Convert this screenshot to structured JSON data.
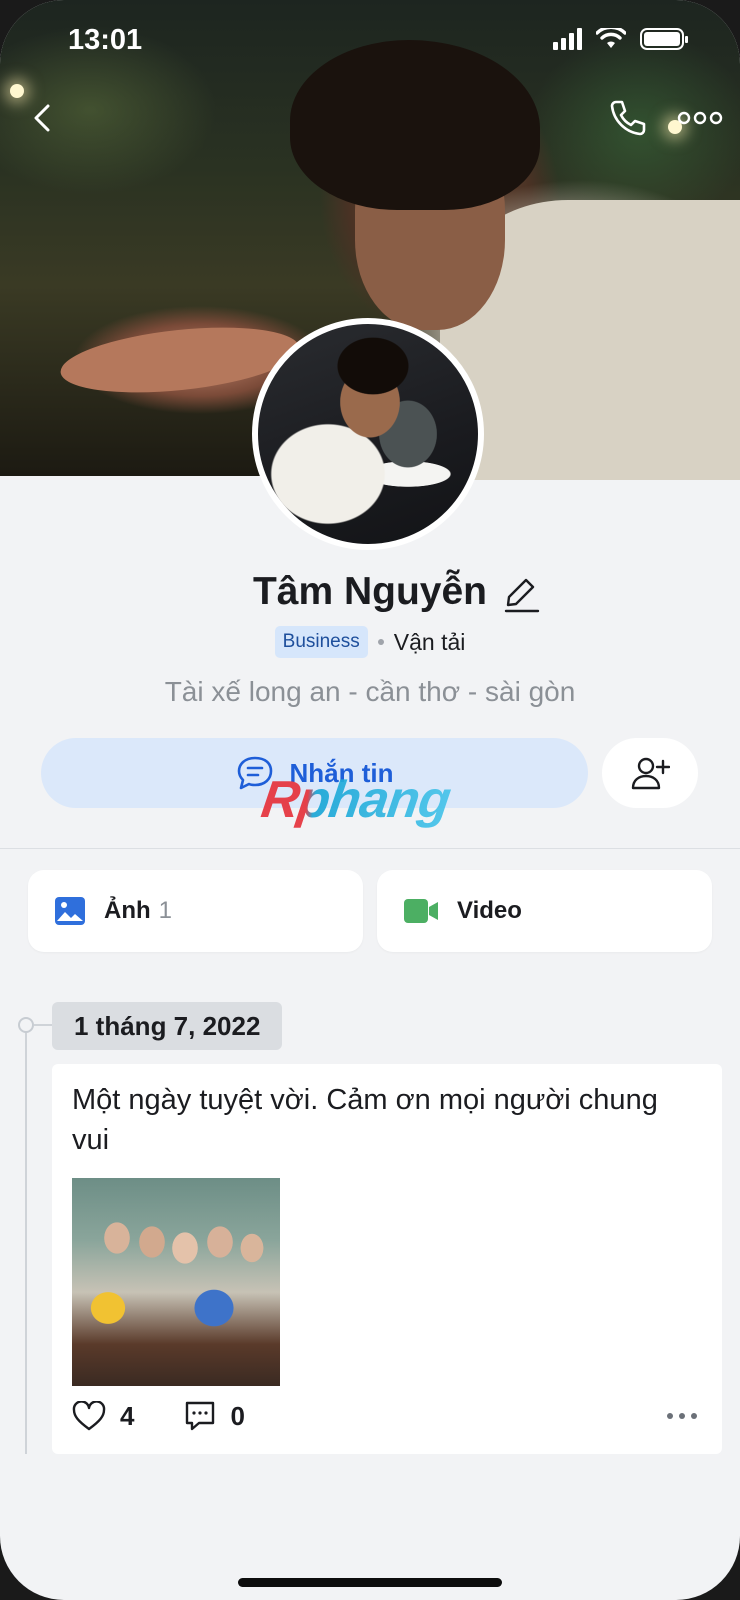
{
  "status_bar": {
    "time": "13:01"
  },
  "profile": {
    "name": "Tâm Nguyễn",
    "badge": "Business",
    "category": "Vận tải",
    "bio": "Tài xế long an - cần thơ - sài gòn"
  },
  "actions": {
    "message_label": "Nhắn tin"
  },
  "watermark": {
    "text": "Rphang"
  },
  "media_tabs": [
    {
      "label": "Ảnh",
      "count": "1"
    },
    {
      "label": "Video"
    }
  ],
  "timeline": {
    "date": "1 tháng 7, 2022",
    "post": {
      "text": "Một ngày tuyệt vời. Cảm ơn mọi người chung vui",
      "likes": "4",
      "comments": "0"
    }
  },
  "colors": {
    "accent": "#1e5ed8",
    "badge_bg": "#d6e6fb",
    "message_bg": "#dbe8fa",
    "video_icon": "#4caf63",
    "photo_icon": "#2f6fdc"
  }
}
